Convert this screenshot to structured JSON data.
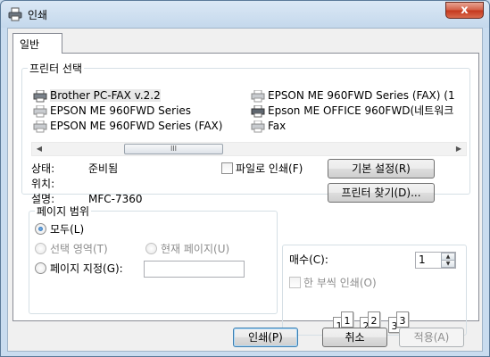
{
  "window": {
    "title": "인쇄",
    "close_glyph": "x"
  },
  "tab": {
    "label": "일반"
  },
  "printer_select": {
    "legend": "프린터 선택",
    "printers": [
      {
        "name": "Brother PC-FAX v.2.2",
        "selected": true
      },
      {
        "name": "EPSON ME 960FWD Series",
        "selected": false
      },
      {
        "name": "EPSON ME 960FWD Series (FAX)",
        "selected": false
      },
      {
        "name": "EPSON ME 960FWD Series (FAX) (1",
        "selected": false
      },
      {
        "name": "Epson ME OFFICE 960FWD(네트워크",
        "selected": false
      },
      {
        "name": "Fax",
        "selected": false
      }
    ],
    "scroll_left": "◀",
    "scroll_right": "▶",
    "thumb_grip": "III",
    "status_label": "상태:",
    "status_value": "준비됨",
    "location_label": "위치:",
    "location_value": "",
    "comment_label": "설명:",
    "comment_value": "MFC-7360",
    "print_to_file_label": "파일로 인쇄(F)",
    "preferences_label": "기본 설정(R)",
    "find_printer_label": "프린터 찾기(D)..."
  },
  "page_range": {
    "legend": "페이지 범위",
    "all_label": "모두(L)",
    "selection_label": "선택 영역(T)",
    "current_page_label": "현재 페이지(U)",
    "pages_label": "페이지 지정(G):",
    "pages_value": ""
  },
  "copies": {
    "label": "매수(C):",
    "value": "1",
    "collate_label": "한 부씩 인쇄(O)",
    "up": "▲",
    "down": "▼",
    "collate_pages": [
      "1",
      "1",
      "2",
      "2",
      "3",
      "3"
    ]
  },
  "buttons": {
    "print": "인쇄(P)",
    "cancel": "취소",
    "apply": "적용(A)"
  }
}
